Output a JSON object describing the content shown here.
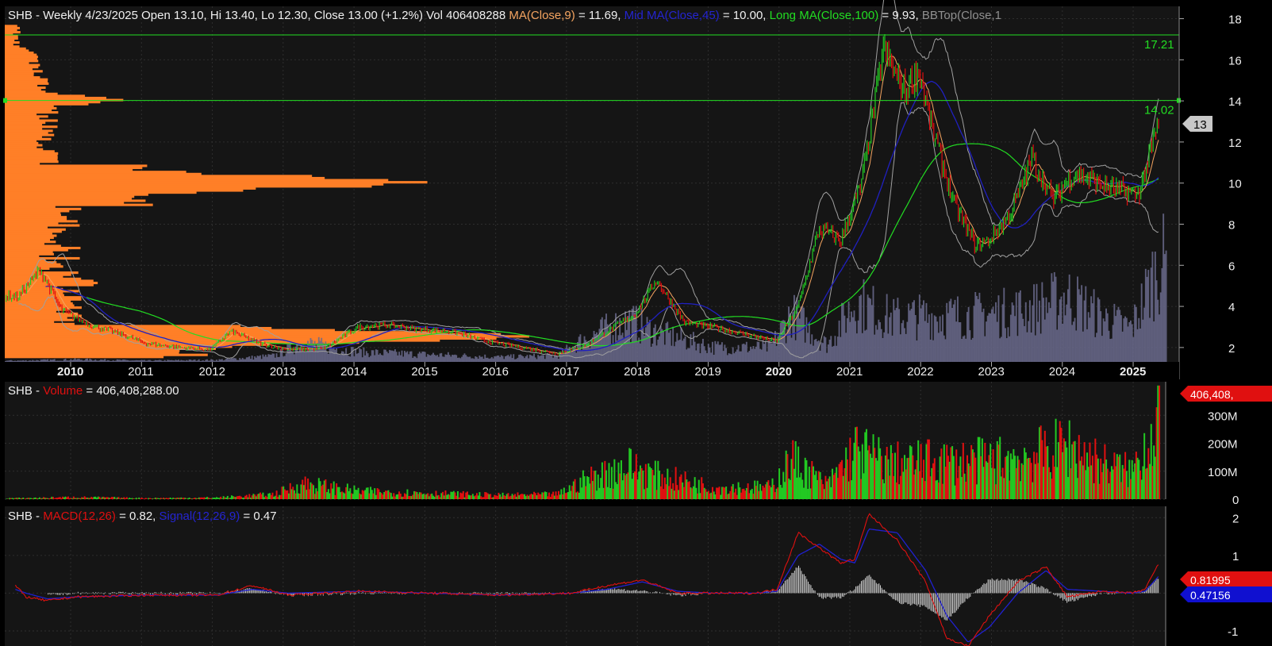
{
  "header": {
    "price_prefix": "SHB - Weekly 4/23/2025 Open 13.10, Hi 13.40, Lo 12.30, Close 13.00 (+1.2%) Vol 406408288",
    "ma_label": "MA(Close,9)",
    "ma_value": " = 11.69,",
    "mid_label": "Mid MA(Close,45)",
    "mid_value": " = 10.00,",
    "long_label": "Long MA(Close,100)",
    "long_value": " = 9.93,",
    "bb_label": "BBTop(Close,1"
  },
  "volume_header": {
    "prefix": "SHB - ",
    "label": "Volume",
    "value": " = 406,408,288.00"
  },
  "macd_header": {
    "prefix": "SHB - ",
    "macd_label": "MACD(12,26)",
    "macd_value": " = 0.82, ",
    "signal_label": "Signal(12,26,9)",
    "signal_value": " = 0.47"
  },
  "price_axis": [
    "18",
    "16",
    "14",
    "12",
    "10",
    "8",
    "6",
    "4",
    "2"
  ],
  "volume_axis": [
    "300M",
    "200M",
    "100M",
    "0"
  ],
  "macd_axis": [
    "2",
    "1",
    "0",
    "-1"
  ],
  "years": [
    "2010",
    "2011",
    "2012",
    "2013",
    "2014",
    "2015",
    "2016",
    "2017",
    "2018",
    "2019",
    "2020",
    "2021",
    "2022",
    "2023",
    "2024",
    "2025"
  ],
  "bold_years": [
    "2010",
    "2020",
    "2025"
  ],
  "levels": [
    {
      "label": "17.21",
      "value": 17.21
    },
    {
      "label": "14.02",
      "value": 14.02
    }
  ],
  "price_tag": "13",
  "volume_tag": "406,408,",
  "macd_tag": "0.81995",
  "signal_tag": "0.47156",
  "colors": {
    "bg": "#000000",
    "panel": "#151515",
    "grid": "#2e2e2e",
    "up": "#22c822",
    "down": "#e01010",
    "ma9": "#f4a460",
    "ma45": "#2020c0",
    "ma100": "#22dd22",
    "bb": "#a0a0a0",
    "volume_profile": "#ff7f27",
    "volume_overlay": "#6a6a8c",
    "macd": "#e01010",
    "signal": "#2020d0",
    "hist": "#d0d0d0",
    "level_line": "#22dd22"
  },
  "chart_data": [
    {
      "type": "candlestick",
      "title": "SHB - Weekly",
      "ylim": [
        1.3,
        18.6
      ],
      "series": [
        {
          "name": "Close",
          "x": [
            2009.2,
            2009.5,
            2009.8,
            2010.2,
            2010.6,
            2011.0,
            2011.5,
            2011.9,
            2012.2,
            2012.6,
            2013.0,
            2013.5,
            2014.0,
            2014.4,
            2014.8,
            2015.3,
            2015.8,
            2016.3,
            2016.8,
            2017.2,
            2017.6,
            2017.9,
            2018.2,
            2018.6,
            2019.0,
            2019.5,
            2019.9,
            2020.2,
            2020.5,
            2020.8,
            2021.1,
            2021.4,
            2021.7,
            2021.9,
            2022.1,
            2022.4,
            2022.7,
            2022.9,
            2023.2,
            2023.5,
            2023.8,
            2024.1,
            2024.5,
            2024.8,
            2025.0,
            2025.3
          ],
          "values": [
            4.5,
            5.8,
            3.8,
            3.1,
            2.7,
            2.2,
            2.0,
            1.9,
            2.8,
            2.2,
            1.9,
            1.95,
            3.0,
            3.1,
            2.9,
            2.8,
            2.3,
            2.0,
            1.7,
            2.1,
            3.0,
            3.6,
            5.3,
            3.2,
            3.0,
            2.6,
            2.3,
            4.0,
            7.8,
            7.2,
            10.0,
            16.5,
            14.5,
            15.5,
            12.5,
            9.0,
            7.0,
            7.2,
            8.5,
            11.2,
            9.2,
            10.5,
            9.9,
            9.6,
            9.4,
            13.0
          ]
        }
      ],
      "levels": [
        17.21,
        14.02
      ],
      "legend": [
        "MA(Close,9) = 11.69",
        "Mid MA(Close,45) = 10.00",
        "Long MA(Close,100) = 9.93"
      ]
    },
    {
      "type": "bar",
      "title": "SHB - Volume",
      "ylim": [
        0,
        420
      ],
      "ylabel": "",
      "x": [
        2009.2,
        2010.0,
        2011.0,
        2012.0,
        2012.8,
        2013.2,
        2014.0,
        2015.0,
        2016.0,
        2016.8,
        2017.2,
        2017.8,
        2018.2,
        2019.0,
        2019.8,
        2020.1,
        2020.6,
        2021.0,
        2021.5,
        2022.0,
        2022.5,
        2023.0,
        2023.5,
        2024.0,
        2024.5,
        2024.9,
        2025.2,
        2025.3
      ],
      "values": [
        5,
        10,
        5,
        8,
        25,
        80,
        40,
        30,
        20,
        25,
        100,
        170,
        120,
        60,
        60,
        200,
        70,
        250,
        180,
        190,
        190,
        200,
        220,
        270,
        180,
        140,
        350,
        406.4
      ]
    },
    {
      "type": "line",
      "title": "SHB - MACD",
      "ylim": [
        -1.4,
        2.3
      ],
      "x": [
        2009.0,
        2009.3,
        2009.6,
        2010.0,
        2011.0,
        2012.0,
        2012.5,
        2013.0,
        2014.0,
        2015.0,
        2016.0,
        2017.0,
        2017.5,
        2018.0,
        2018.5,
        2019.0,
        2019.6,
        2019.9,
        2020.2,
        2020.5,
        2020.8,
        2021.0,
        2021.2,
        2021.6,
        2022.0,
        2022.3,
        2022.6,
        2022.9,
        2023.3,
        2023.7,
        2024.0,
        2024.5,
        2024.9,
        2025.1,
        2025.3
      ],
      "series": [
        {
          "name": "MACD(12,26)",
          "values": [
            0.5,
            -0.1,
            -0.2,
            -0.1,
            -0.05,
            -0.05,
            0.2,
            -0.05,
            0.05,
            0.0,
            -0.05,
            0.0,
            0.2,
            0.35,
            0.0,
            0.0,
            0.0,
            0.1,
            1.6,
            1.2,
            0.8,
            0.9,
            2.1,
            1.4,
            0.3,
            -1.2,
            -1.4,
            -0.6,
            0.3,
            0.7,
            -0.1,
            0.05,
            0.0,
            0.1,
            0.82
          ]
        },
        {
          "name": "Signal(12,26,9)",
          "values": [
            0.2,
            0.0,
            -0.15,
            -0.1,
            -0.05,
            -0.05,
            0.1,
            0.0,
            0.05,
            0.0,
            -0.05,
            0.0,
            0.1,
            0.3,
            0.05,
            0.0,
            0.0,
            0.05,
            1.0,
            1.3,
            0.9,
            0.8,
            1.7,
            1.6,
            0.6,
            -0.6,
            -1.3,
            -0.9,
            0.0,
            0.6,
            0.1,
            0.05,
            0.0,
            0.05,
            0.47
          ]
        }
      ]
    }
  ]
}
